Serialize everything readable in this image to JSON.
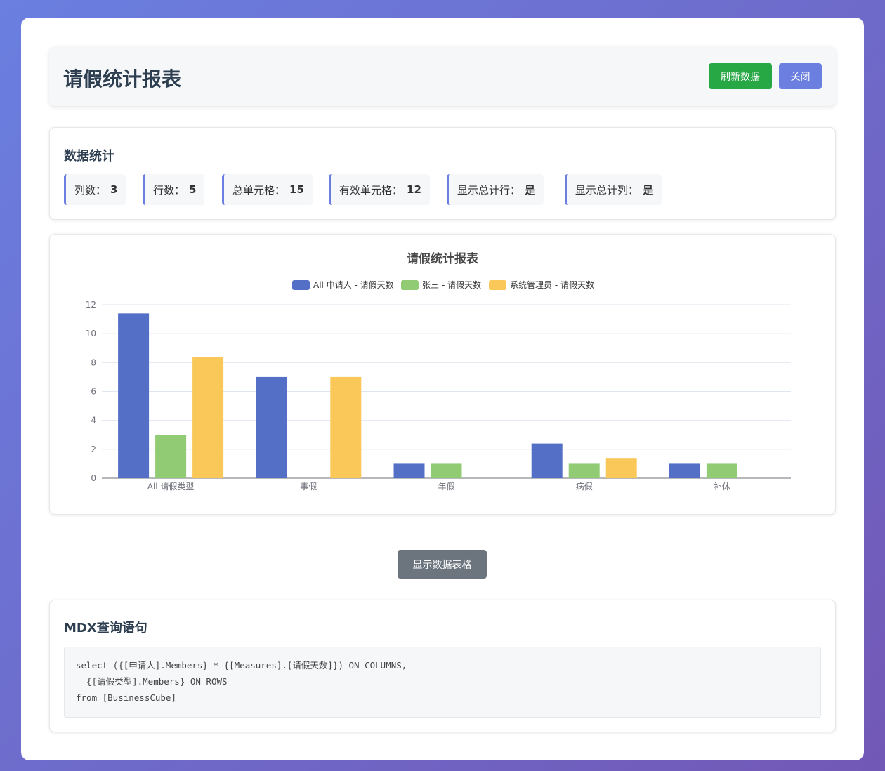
{
  "header": {
    "title": "请假统计报表",
    "refresh_label": "刷新数据",
    "close_label": "关闭"
  },
  "stats": {
    "title": "数据统计",
    "items": [
      {
        "label": "列数：",
        "value": "3"
      },
      {
        "label": "行数：",
        "value": "5"
      },
      {
        "label": "总单元格：",
        "value": "15"
      },
      {
        "label": "有效单元格：",
        "value": "12"
      },
      {
        "label": "显示总计行：",
        "value": "是"
      },
      {
        "label": "显示总计列：",
        "value": "是"
      }
    ]
  },
  "colors": {
    "accent": "#6a7fe0",
    "refresh": "#28a745",
    "toggle": "#6c757d"
  },
  "chart_data": {
    "type": "bar",
    "title": "请假统计报表",
    "categories": [
      "All 请假类型",
      "事假",
      "年假",
      "病假",
      "补休"
    ],
    "series": [
      {
        "name": "All 申请人 - 请假天数",
        "color": "#5470c6",
        "values": [
          11.4,
          7,
          1,
          2.4,
          1
        ]
      },
      {
        "name": "张三 - 请假天数",
        "color": "#91cc75",
        "values": [
          3,
          0,
          1,
          1,
          1
        ]
      },
      {
        "name": "系统管理员 - 请假天数",
        "color": "#fac858",
        "values": [
          8.4,
          7,
          0,
          1.4,
          0
        ]
      }
    ],
    "ylim": [
      0,
      12
    ],
    "yticks": [
      "0",
      "2",
      "4",
      "6",
      "8",
      "10",
      "12"
    ],
    "grid": true,
    "legend": "top-center"
  },
  "toggle_label": "显示数据表格",
  "mdx": {
    "title": "MDX查询语句",
    "code": "select ({[申请人].Members} * {[Measures].[请假天数]}) ON COLUMNS,\n  {[请假类型].Members} ON ROWS\nfrom [BusinessCube]"
  }
}
